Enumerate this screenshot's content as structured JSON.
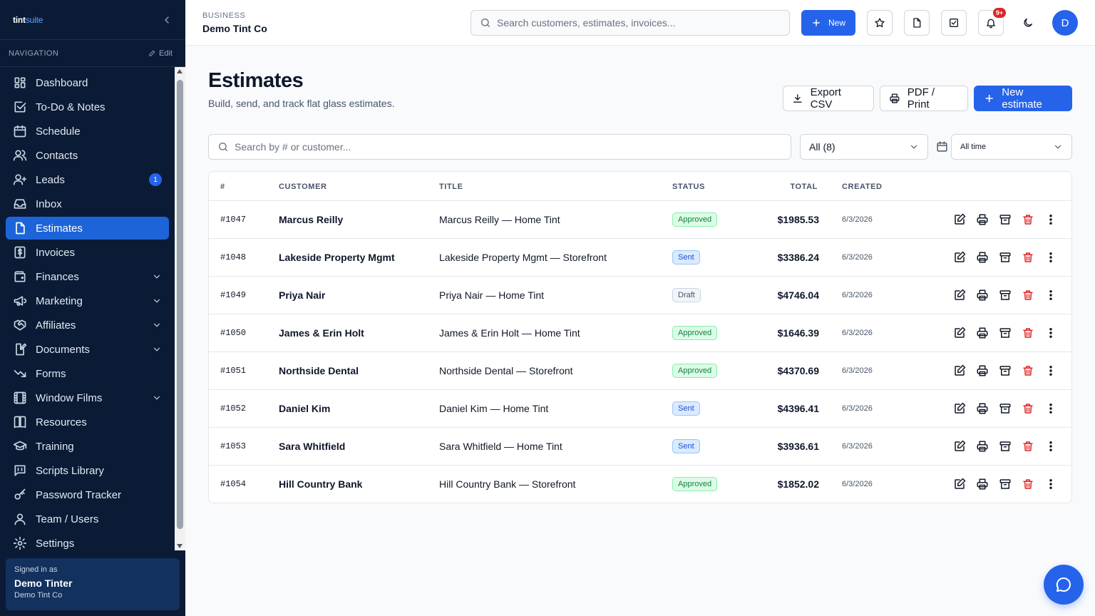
{
  "brand": {
    "part1": "tint",
    "part2": "suite"
  },
  "sidebar": {
    "nav_heading": "NAVIGATION",
    "edit_label": "Edit",
    "items": [
      {
        "label": "Dashboard",
        "icon": "grid-icon"
      },
      {
        "label": "To-Do & Notes",
        "icon": "checkbox-icon"
      },
      {
        "label": "Schedule",
        "icon": "calendar-icon"
      },
      {
        "label": "Contacts",
        "icon": "users-icon"
      },
      {
        "label": "Leads",
        "icon": "user-plus-icon",
        "badge": "1"
      },
      {
        "label": "Inbox",
        "icon": "inbox-icon"
      },
      {
        "label": "Estimates",
        "icon": "file-icon",
        "active": true
      },
      {
        "label": "Invoices",
        "icon": "dollar-doc-icon"
      },
      {
        "label": "Finances",
        "icon": "wallet-icon",
        "expandable": true
      },
      {
        "label": "Marketing",
        "icon": "megaphone-icon",
        "expandable": true
      },
      {
        "label": "Affiliates",
        "icon": "handshake-icon",
        "expandable": true
      },
      {
        "label": "Documents",
        "icon": "document-edit-icon",
        "expandable": true
      },
      {
        "label": "Forms",
        "icon": "trend-icon"
      },
      {
        "label": "Window Films",
        "icon": "film-icon",
        "expandable": true
      },
      {
        "label": "Resources",
        "icon": "book-icon"
      },
      {
        "label": "Training",
        "icon": "graduation-cap-icon"
      },
      {
        "label": "Scripts Library",
        "icon": "message-square-icon"
      },
      {
        "label": "Password Tracker",
        "icon": "key-icon"
      },
      {
        "label": "Team / Users",
        "icon": "user-icon"
      },
      {
        "label": "Settings",
        "icon": "gear-icon"
      }
    ],
    "signed_in": {
      "label": "Signed in as",
      "name": "Demo Tinter",
      "business": "Demo Tint Co"
    }
  },
  "topbar": {
    "business_label": "BUSINESS",
    "business_name": "Demo Tint Co",
    "search_placeholder": "Search customers, estimates, invoices...",
    "new_label": "New",
    "notification_badge": "9+",
    "avatar_initial": "D"
  },
  "main": {
    "title": "Estimates",
    "subtitle": "Build, send, and track flat glass estimates.",
    "export_label": "Export CSV",
    "pdf_label": "PDF / Print",
    "new_estimate_label": "New estimate",
    "search_placeholder": "Search by # or customer...",
    "status_filter": "All (8)",
    "date_filter": "All time"
  },
  "table": {
    "headers": {
      "num": "#",
      "customer": "CUSTOMER",
      "title": "TITLE",
      "status": "STATUS",
      "total": "TOTAL",
      "created": "CREATED"
    },
    "rows": [
      {
        "num": "#1047",
        "customer": "Marcus Reilly",
        "title": "Marcus Reilly — Home Tint",
        "status": "Approved",
        "status_kind": "approved",
        "total": "$1985.53",
        "created": "6/3/2026"
      },
      {
        "num": "#1048",
        "customer": "Lakeside Property Mgmt",
        "title": "Lakeside Property Mgmt — Storefront",
        "status": "Sent",
        "status_kind": "sent",
        "total": "$3386.24",
        "created": "6/3/2026"
      },
      {
        "num": "#1049",
        "customer": "Priya Nair",
        "title": "Priya Nair — Home Tint",
        "status": "Draft",
        "status_kind": "draft",
        "total": "$4746.04",
        "created": "6/3/2026"
      },
      {
        "num": "#1050",
        "customer": "James & Erin Holt",
        "title": "James & Erin Holt — Home Tint",
        "status": "Approved",
        "status_kind": "approved",
        "total": "$1646.39",
        "created": "6/3/2026"
      },
      {
        "num": "#1051",
        "customer": "Northside Dental",
        "title": "Northside Dental — Storefront",
        "status": "Approved",
        "status_kind": "approved",
        "total": "$4370.69",
        "created": "6/3/2026"
      },
      {
        "num": "#1052",
        "customer": "Daniel Kim",
        "title": "Daniel Kim — Home Tint",
        "status": "Sent",
        "status_kind": "sent",
        "total": "$4396.41",
        "created": "6/3/2026"
      },
      {
        "num": "#1053",
        "customer": "Sara Whitfield",
        "title": "Sara Whitfield — Home Tint",
        "status": "Sent",
        "status_kind": "sent",
        "total": "$3936.61",
        "created": "6/3/2026"
      },
      {
        "num": "#1054",
        "customer": "Hill Country Bank",
        "title": "Hill Country Bank — Storefront",
        "status": "Approved",
        "status_kind": "approved",
        "total": "$1852.02",
        "created": "6/3/2026"
      }
    ]
  },
  "colors": {
    "sidebar_bg": "#0b1b36",
    "accent": "#2563eb",
    "danger": "#dc2626"
  }
}
